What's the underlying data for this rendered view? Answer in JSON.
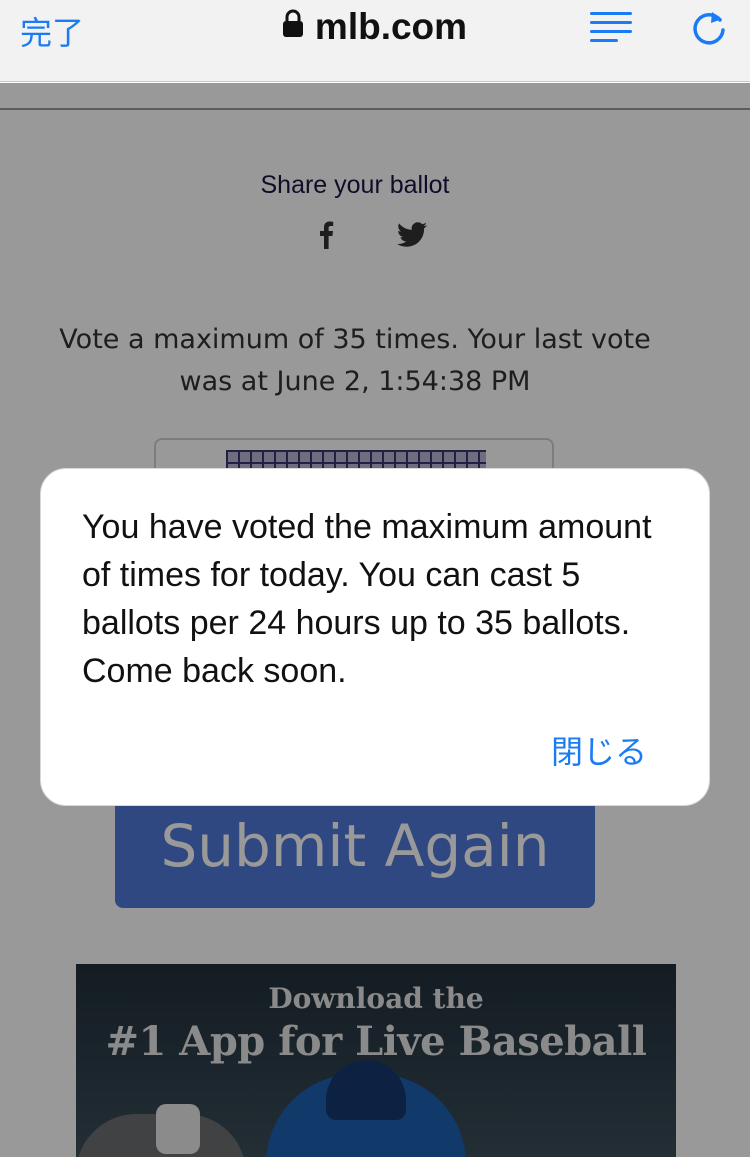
{
  "browser": {
    "done_label": "完了",
    "url": "mlb.com",
    "accent_color": "#1a7cf5",
    "icons": [
      "lock-icon",
      "reader-icon",
      "reload-icon"
    ]
  },
  "page": {
    "share_label": "Share your ballot",
    "share_icons": [
      "facebook-icon",
      "twitter-icon"
    ],
    "vote_info_line1": "Vote a maximum of 35 times. Your last vote",
    "vote_info_line2": "was at June 2, 1:54:38 PM",
    "submit_label": "Submit Again",
    "submit_color": "#4f78d9",
    "ad": {
      "line1": "Download the",
      "line2": "#1 App for Live Baseball"
    }
  },
  "alert": {
    "message": "You have voted the maximum amount of times for today. You can cast 5 ballots per 24 hours up to 35 ballots. Come back soon.",
    "close_label": "閉じる"
  }
}
